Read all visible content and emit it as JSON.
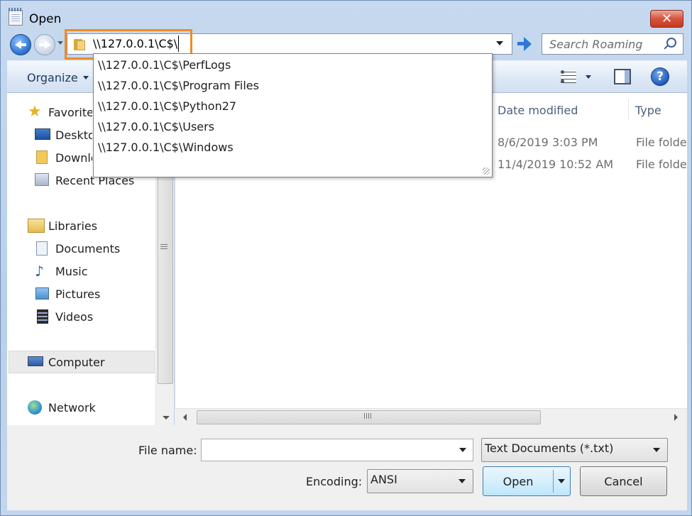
{
  "window": {
    "title": "Open",
    "close_label": "✕"
  },
  "address_bar": {
    "value": "\\\\127.0.0.1\\C$\\"
  },
  "search": {
    "placeholder": "Search Roaming"
  },
  "toolbar": {
    "organize_label": "Organize",
    "help_label": "?"
  },
  "suggestions": [
    "\\\\127.0.0.1\\C$\\PerfLogs",
    "\\\\127.0.0.1\\C$\\Program Files",
    "\\\\127.0.0.1\\C$\\Python27",
    "\\\\127.0.0.1\\C$\\Users",
    "\\\\127.0.0.1\\C$\\Windows"
  ],
  "nav": {
    "favorites": "Favorites",
    "desktop": "Desktop",
    "downloads": "Downloads",
    "recent_places": "Recent Places",
    "libraries": "Libraries",
    "documents": "Documents",
    "music": "Music",
    "pictures": "Pictures",
    "videos": "Videos",
    "computer": "Computer",
    "network": "Network"
  },
  "columns": {
    "date_modified": "Date modified",
    "type": "Type"
  },
  "rows": [
    {
      "date": "8/6/2019 3:03 PM",
      "type": "File folder"
    },
    {
      "date": "11/4/2019 10:52 AM",
      "type": "File folder"
    }
  ],
  "bottom": {
    "file_name_label": "File name:",
    "file_name_value": "",
    "file_type": "Text Documents (*.txt)",
    "encoding_label": "Encoding:",
    "encoding_value": "ANSI",
    "open_label": "Open",
    "cancel_label": "Cancel"
  },
  "colors": {
    "highlight": "#f08a24",
    "accent": "#2e79d8"
  }
}
